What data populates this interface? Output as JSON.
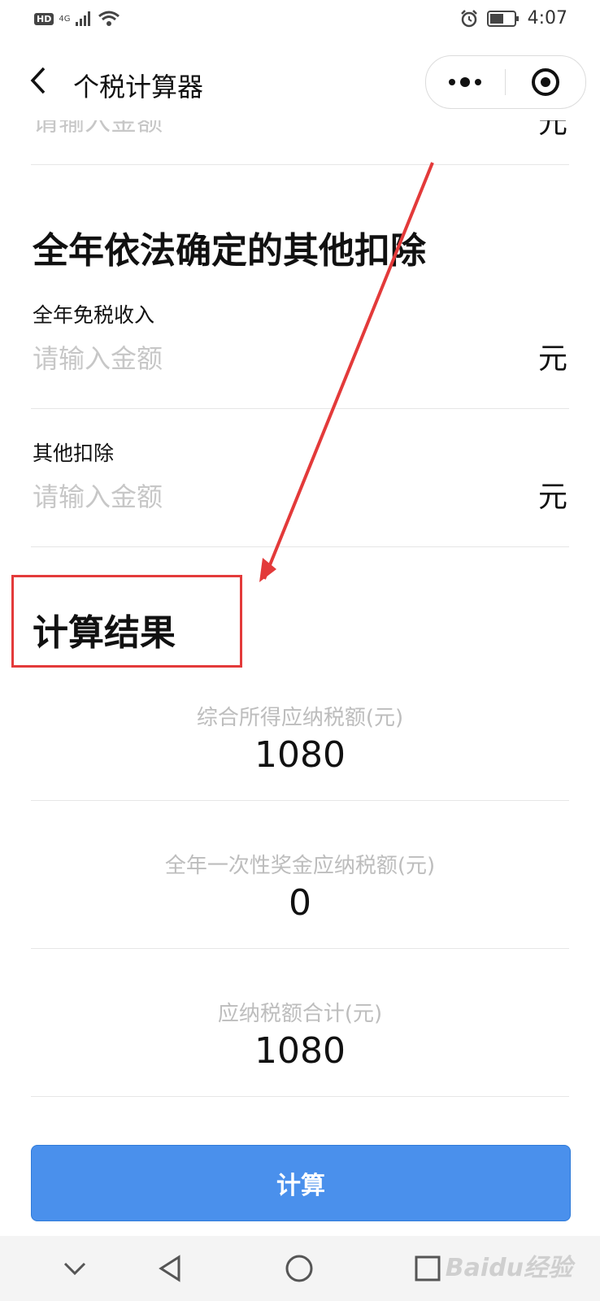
{
  "status_bar": {
    "hd": "HD",
    "network": "4G",
    "time": "4:07"
  },
  "nav": {
    "title": "个税计算器"
  },
  "fields": [
    {
      "input_placeholder": "请输入金额",
      "unit": "元"
    },
    {
      "label": "全年免税收入",
      "input_placeholder": "请输入金额",
      "unit": "元"
    },
    {
      "label": "其他扣除",
      "input_placeholder": "请输入金额",
      "unit": "元"
    }
  ],
  "sections": {
    "other_deductions_title": "全年依法确定的其他扣除",
    "result_title": "计算结果"
  },
  "results": [
    {
      "label": "综合所得应纳税额(元)",
      "value": "1080"
    },
    {
      "label": "全年一次性奖金应纳税额(元)",
      "value": "0"
    },
    {
      "label": "应纳税额合计(元)",
      "value": "1080"
    }
  ],
  "calculate_button": "计算",
  "watermark": "Baidu经验",
  "colors": {
    "accent": "#4a90ec",
    "annotation": "#e33a3a",
    "placeholder": "#c7c7c7"
  }
}
